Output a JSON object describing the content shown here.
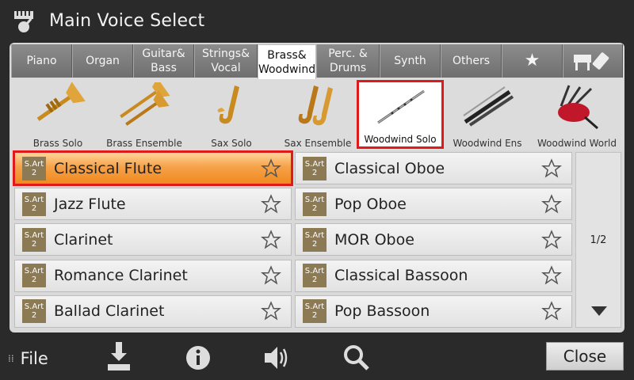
{
  "title": "Main Voice Select",
  "tabs": [
    {
      "label": "Piano"
    },
    {
      "label": "Organ"
    },
    {
      "label": "Guitar&\nBass"
    },
    {
      "label": "Strings&\nVocal"
    },
    {
      "label": "Brass&\nWoodwind",
      "active": true
    },
    {
      "label": "Perc. &\nDrums"
    },
    {
      "label": "Synth"
    },
    {
      "label": "Others"
    },
    {
      "label": "★"
    }
  ],
  "categories": [
    {
      "label": "Brass Solo",
      "icon": "trumpet-icon"
    },
    {
      "label": "Brass Ensemble",
      "icon": "brass-ensemble-icon"
    },
    {
      "label": "Sax Solo",
      "icon": "saxophone-icon"
    },
    {
      "label": "Sax Ensemble",
      "icon": "sax-ensemble-icon"
    },
    {
      "label": "Woodwind Solo",
      "icon": "flute-icon",
      "selected": true
    },
    {
      "label": "Woodwind Ens",
      "icon": "woodwind-ens-icon"
    },
    {
      "label": "Woodwind World",
      "icon": "bagpipe-icon"
    }
  ],
  "badge": {
    "line1": "S.Art",
    "line2": "2"
  },
  "voices_left": [
    {
      "name": "Classical Flute",
      "selected": true
    },
    {
      "name": "Jazz Flute"
    },
    {
      "name": "Clarinet"
    },
    {
      "name": "Romance Clarinet"
    },
    {
      "name": "Ballad Clarinet"
    }
  ],
  "voices_right": [
    {
      "name": "Classical Oboe"
    },
    {
      "name": "Pop Oboe"
    },
    {
      "name": "MOR Oboe"
    },
    {
      "name": "Classical Bassoon"
    },
    {
      "name": "Pop Bassoon"
    }
  ],
  "pager": {
    "label": "1/2"
  },
  "bottom": {
    "file_label": "File",
    "close_label": "Close"
  }
}
